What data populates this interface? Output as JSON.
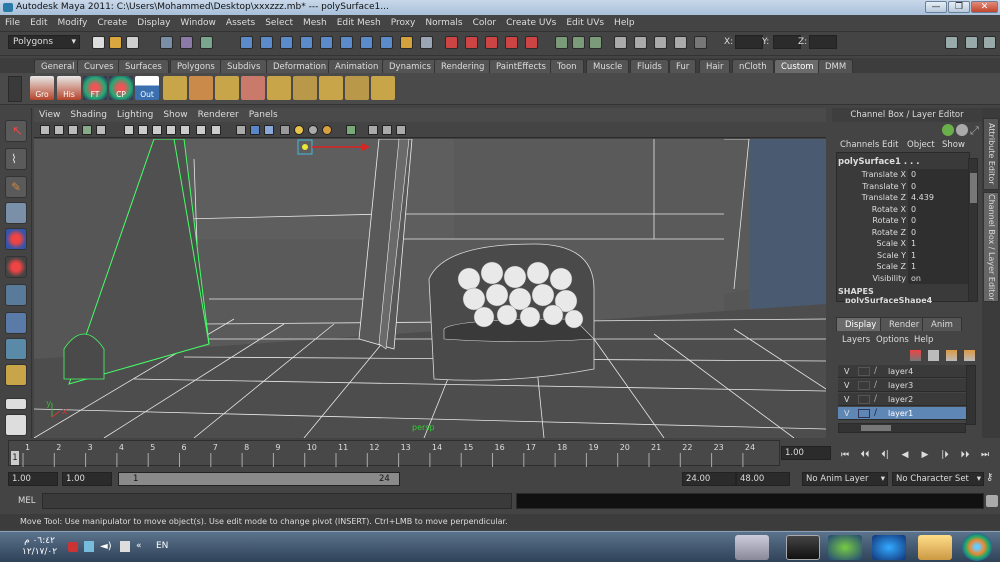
{
  "window": {
    "title": "Autodesk Maya 2011: C:\\Users\\Mohammed\\Desktop\\xxxzzz.mb*   ---   polySurface1...",
    "minimize": "—",
    "restore": "❐",
    "close": "✕"
  },
  "menubar": [
    "File",
    "Edit",
    "Modify",
    "Create",
    "Display",
    "Window",
    "Assets",
    "Select",
    "Mesh",
    "Edit Mesh",
    "Proxy",
    "Normals",
    "Color",
    "Create UVs",
    "Edit UVs",
    "Help"
  ],
  "statusline": {
    "mode": "Polygons",
    "x_label": "X:",
    "y_label": "Y:",
    "z_label": "Z:"
  },
  "shelf_tabs": [
    "General",
    "Curves",
    "Surfaces",
    "Polygons",
    "Subdivs",
    "Deformation",
    "Animation",
    "Dynamics",
    "Rendering",
    "PaintEffects",
    "Toon",
    "Muscle",
    "Fluids",
    "Fur",
    "Hair",
    "nCloth",
    "Custom",
    "DMM"
  ],
  "shelf_active_tab": "Custom",
  "shelf_buttons": [
    "Gro",
    "His",
    "FT",
    "CP",
    "Out"
  ],
  "viewport": {
    "menu": [
      "View",
      "Shading",
      "Lighting",
      "Show",
      "Renderer",
      "Panels"
    ],
    "camera_label": "persp",
    "axis_x": "x",
    "axis_y": "y"
  },
  "channel_box": {
    "title": "Channel Box / Layer Editor",
    "menu": [
      "Channels",
      "Edit",
      "Object",
      "Show"
    ],
    "object_name": "polySurface1 . . .",
    "attributes": [
      {
        "name": "Translate X",
        "value": "0"
      },
      {
        "name": "Translate Y",
        "value": "0"
      },
      {
        "name": "Translate Z",
        "value": "4.439"
      },
      {
        "name": "Rotate X",
        "value": "0"
      },
      {
        "name": "Rotate Y",
        "value": "0"
      },
      {
        "name": "Rotate Z",
        "value": "0"
      },
      {
        "name": "Scale X",
        "value": "1"
      },
      {
        "name": "Scale Y",
        "value": "1"
      },
      {
        "name": "Scale Z",
        "value": "1"
      },
      {
        "name": "Visibility",
        "value": "on"
      }
    ],
    "shapes_label": "SHAPES",
    "shape_name": "polySurfaceShape4"
  },
  "side_tabs": [
    "Attribute Editor",
    "Channel Box / Layer Editor"
  ],
  "layer_editor": {
    "tabs": [
      "Display",
      "Render",
      "Anim"
    ],
    "active_tab": "Display",
    "menu": [
      "Layers",
      "Options",
      "Help"
    ],
    "layers": [
      {
        "v": "V",
        "name": "layer4",
        "selected": false
      },
      {
        "v": "V",
        "name": "layer3",
        "selected": false
      },
      {
        "v": "V",
        "name": "layer2",
        "selected": false
      },
      {
        "v": "V",
        "name": "layer1",
        "selected": true
      }
    ]
  },
  "timeline": {
    "ticks": [
      "1",
      "2",
      "3",
      "4",
      "5",
      "6",
      "7",
      "8",
      "9",
      "10",
      "11",
      "12",
      "13",
      "14",
      "15",
      "16",
      "17",
      "18",
      "19",
      "20",
      "21",
      "22",
      "23",
      "24"
    ],
    "current_frame": "1.00",
    "current_marker": "1"
  },
  "range": {
    "start": "1.00",
    "start2": "1.00",
    "slider_start": "1",
    "slider_end": "24",
    "end": "24.00",
    "end2": "48.00",
    "anim_layer": "No Anim Layer",
    "character_set": "No Character Set"
  },
  "playback": [
    "⏮",
    "⏴⏴",
    "⏴|",
    "◀",
    "▶",
    "|⏵",
    "⏵⏵",
    "⏭"
  ],
  "command_line": {
    "label": "MEL"
  },
  "help_line": "Move Tool: Use manipulator to move object(s). Use edit mode to change pivot (INSERT).  Ctrl+LMB to move perpendicular.",
  "taskbar": {
    "lang": "EN",
    "time": "٠٦:٤٢ م",
    "date": "١٢/١٧/٠٢"
  },
  "colors": {
    "ui_bg": "#444444",
    "viewport_bg": "#555555",
    "selection_wire": "#44ff66",
    "active_tab": "#6b6b6b",
    "layer_selected": "#5f87b5"
  }
}
